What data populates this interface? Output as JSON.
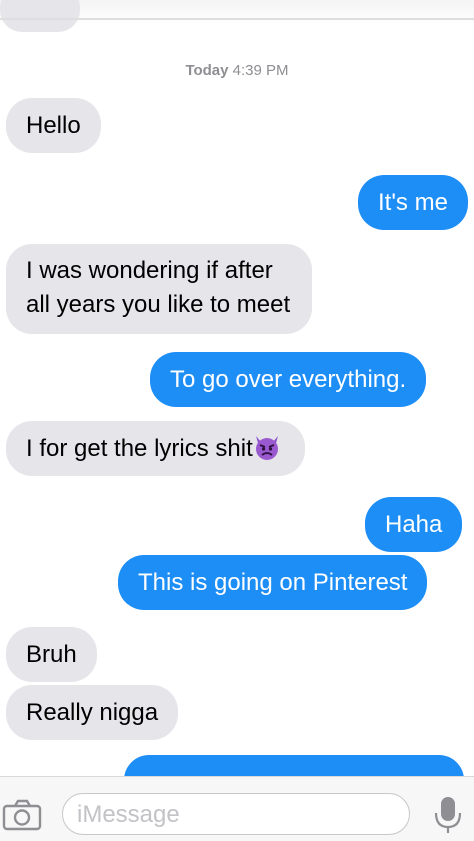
{
  "header": {
    "timestamp_day": "Today",
    "timestamp_time": "4:39 PM"
  },
  "messages": [
    {
      "direction": "incoming",
      "text": "Hello"
    },
    {
      "direction": "outgoing",
      "text": "It's me"
    },
    {
      "direction": "incoming",
      "lines": [
        "I was wondering if after",
        "all years you like to meet"
      ]
    },
    {
      "direction": "outgoing",
      "text": "To go over everything."
    },
    {
      "direction": "incoming",
      "text": "I for get the lyrics shit",
      "emoji": "angry-devil"
    },
    {
      "direction": "outgoing",
      "text": "Haha"
    },
    {
      "direction": "outgoing",
      "text": "This is going on Pinterest"
    },
    {
      "direction": "incoming",
      "text": "Bruh"
    },
    {
      "direction": "incoming",
      "text": "Really nigga"
    }
  ],
  "input": {
    "placeholder": "iMessage"
  },
  "icons": {
    "camera": "camera-icon",
    "microphone": "microphone-icon",
    "emoji": "angry-devil-emoji-icon"
  },
  "colors": {
    "incoming_bubble": "#e5e5ea",
    "outgoing_bubble": "#1e8ef7",
    "timestamp": "#8e8e93"
  }
}
